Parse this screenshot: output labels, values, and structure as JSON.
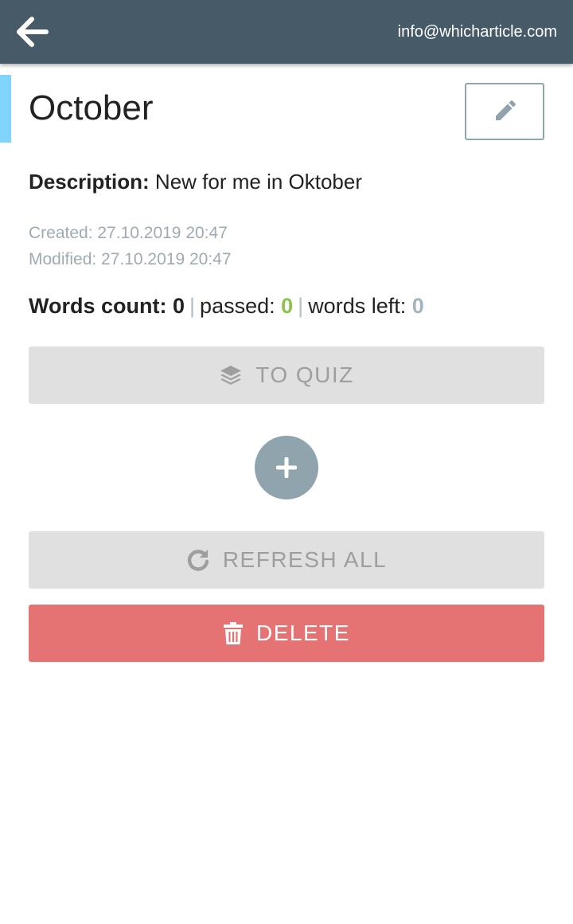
{
  "header": {
    "back_icon": "arrow-left-icon",
    "email": "info@whicharticle.com",
    "background_color": "#465a68"
  },
  "list": {
    "title": "October",
    "accent_color": "#81d4fa",
    "edit_icon": "pencil-icon",
    "description_label": "Description:",
    "description_value": "New for me in Oktober",
    "created": "Created: 27.10.2019 20:47",
    "modified": "Modified: 27.10.2019 20:47"
  },
  "stats": {
    "words_count_label": "Words count:",
    "words_count_value": "0",
    "separator": "|",
    "passed_label": "passed:",
    "passed_value": "0",
    "passed_color": "#8bc34a",
    "words_left_label": "words left:",
    "words_left_value": "0"
  },
  "actions": {
    "quiz_label": "TO QUIZ",
    "quiz_icon": "layers-icon",
    "add_icon": "plus-icon",
    "refresh_label": "REFRESH ALL",
    "refresh_icon": "refresh-icon",
    "delete_label": "DELETE",
    "delete_icon": "trash-icon",
    "delete_color": "#e57373"
  }
}
